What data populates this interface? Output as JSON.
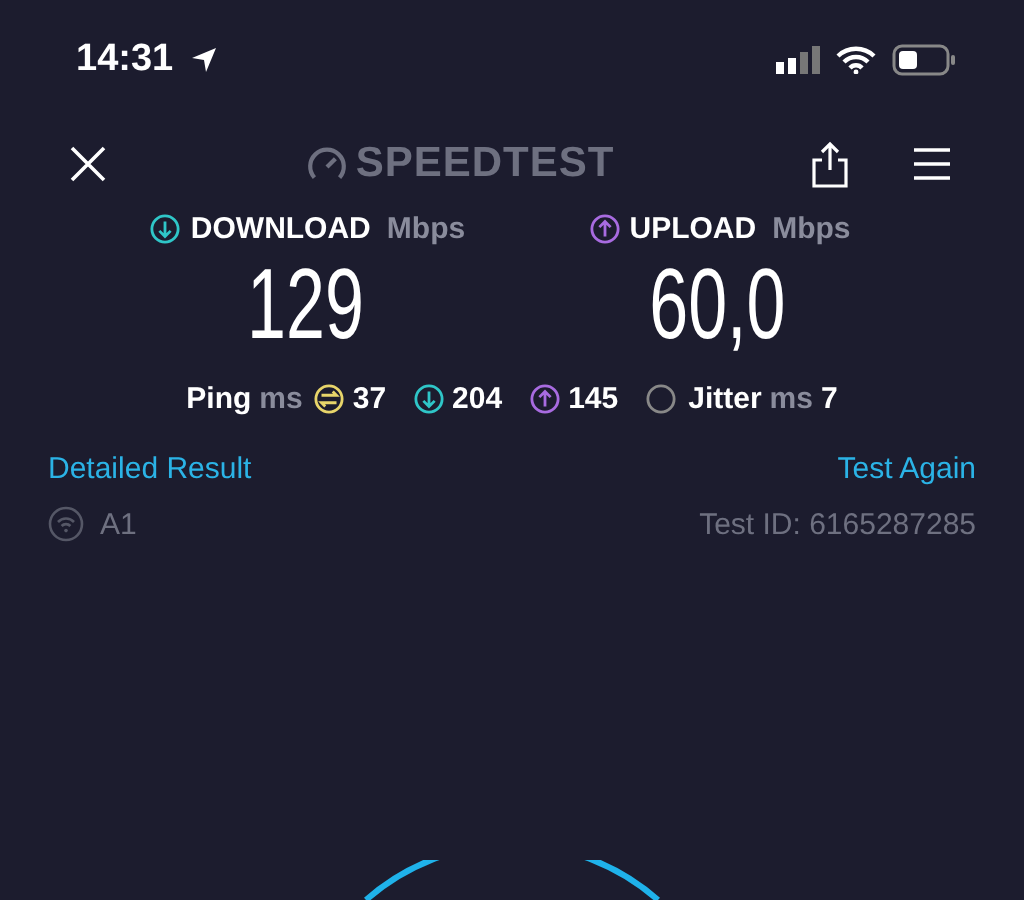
{
  "status_bar": {
    "time": "14:31"
  },
  "header": {
    "logo": "SPEEDTEST"
  },
  "metrics": [
    {
      "kind": "download",
      "label": "DOWNLOAD",
      "unit": "Mbps",
      "value": "129"
    },
    {
      "kind": "upload",
      "label": "UPLOAD",
      "unit": "Mbps",
      "value": "60,0"
    }
  ],
  "latency": {
    "label": "Ping",
    "unit": "ms",
    "items": [
      {
        "kind": "ping",
        "value": "37"
      },
      {
        "kind": "download",
        "value": "204"
      },
      {
        "kind": "upload",
        "value": "145"
      }
    ],
    "jitter": {
      "label": "Jitter",
      "unit": "ms",
      "value": "7"
    }
  },
  "links": {
    "detailed": "Detailed Result",
    "again": "Test Again"
  },
  "provider": {
    "name": "A1",
    "test_id": "Test ID: 6165287285"
  }
}
